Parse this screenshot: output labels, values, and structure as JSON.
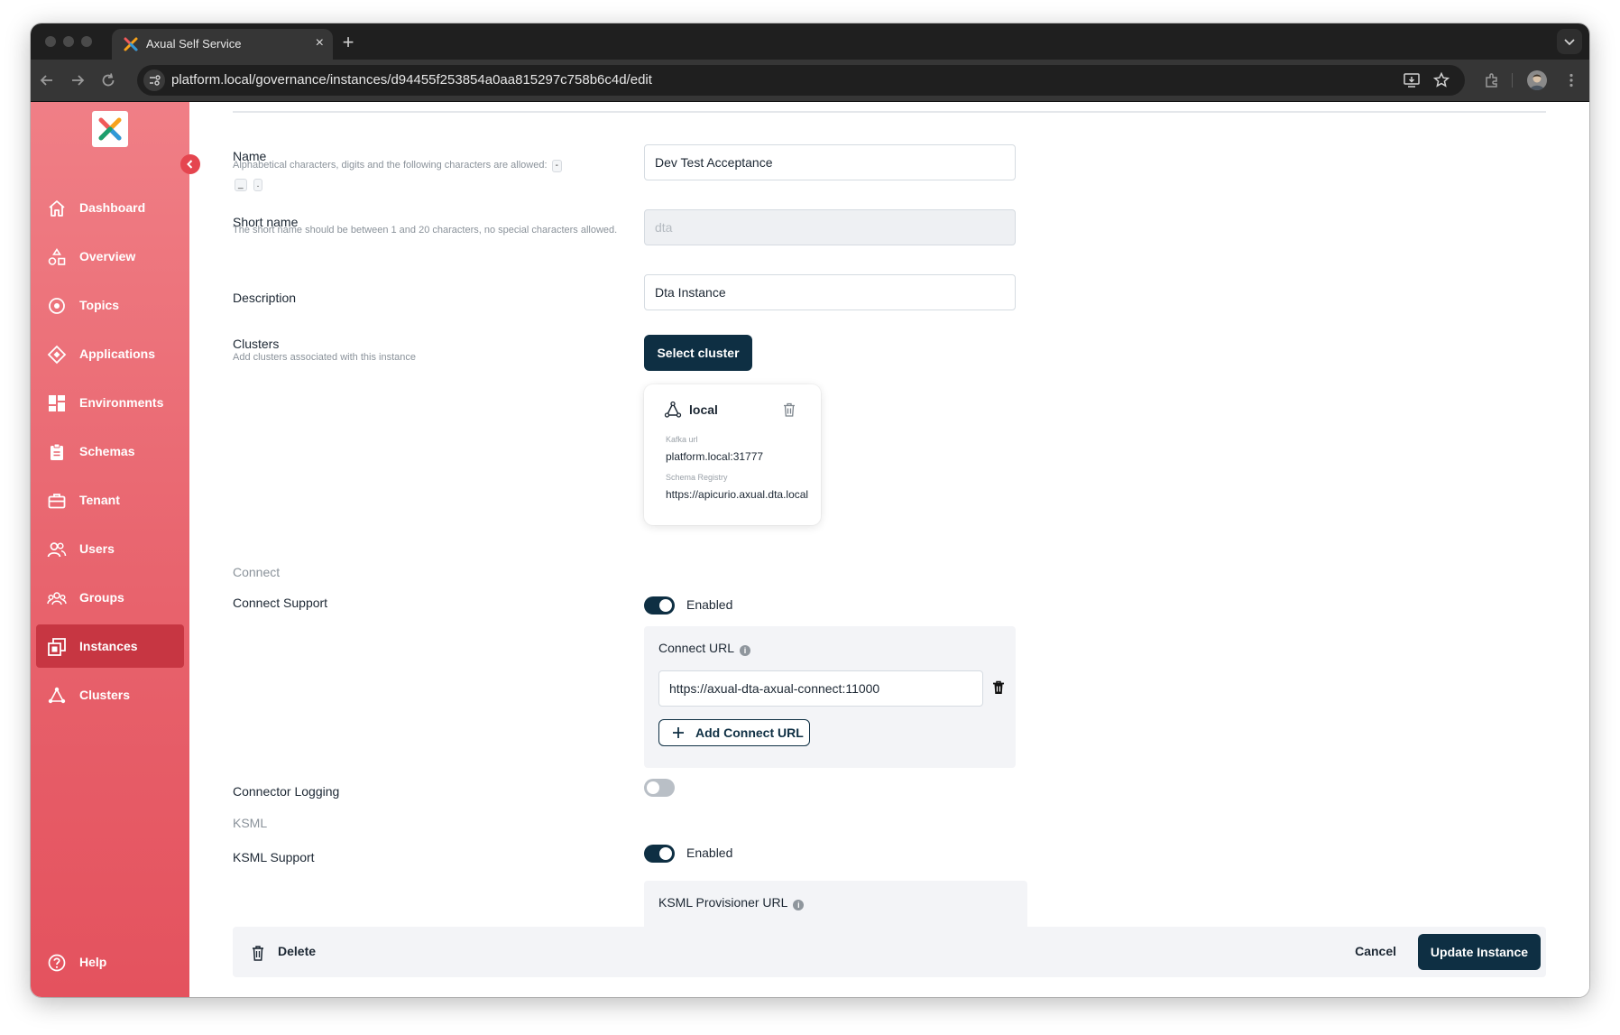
{
  "browser": {
    "tab_title": "Axual Self Service",
    "tab_close": "×",
    "new_tab": "+",
    "url": "platform.local/governance/instances/d94455f253854a0aa815297c758b6c4d/edit"
  },
  "sidebar": {
    "items": [
      {
        "label": "Dashboard",
        "icon": "home-icon"
      },
      {
        "label": "Overview",
        "icon": "shapes-icon"
      },
      {
        "label": "Topics",
        "icon": "topic-icon"
      },
      {
        "label": "Applications",
        "icon": "diamond-icon"
      },
      {
        "label": "Environments",
        "icon": "grid-icon"
      },
      {
        "label": "Schemas",
        "icon": "clipboard-icon"
      },
      {
        "label": "Tenant",
        "icon": "tenant-icon"
      },
      {
        "label": "Users",
        "icon": "users-icon"
      },
      {
        "label": "Groups",
        "icon": "groups-icon"
      },
      {
        "label": "Instances",
        "icon": "instances-icon"
      },
      {
        "label": "Clusters",
        "icon": "cluster-icon"
      }
    ],
    "active": "Instances",
    "help": "Help"
  },
  "form": {
    "name": {
      "label": "Name",
      "help": "Alphabetical characters, digits and the following characters are allowed:",
      "chars": [
        "-",
        "_",
        "."
      ],
      "value": "Dev Test Acceptance"
    },
    "short_name": {
      "label": "Short name",
      "help": "The short name should be between 1 and 20 characters, no special characters allowed.",
      "value": "dta"
    },
    "description": {
      "label": "Description",
      "value": "Dta Instance"
    },
    "clusters": {
      "label": "Clusters",
      "help": "Add clusters associated with this instance",
      "button": "Select cluster",
      "card": {
        "name": "local",
        "kafka_label": "Kafka url",
        "kafka_url": "platform.local:31777",
        "schema_label": "Schema Registry",
        "schema_url": "https://apicurio.axual.dta.local"
      }
    },
    "connect": {
      "section": "Connect",
      "support_label": "Connect Support",
      "support_state": "Enabled",
      "url_title": "Connect URL",
      "url_value": "https://axual-dta-axual-connect:11000",
      "add_button": "Add Connect URL",
      "logging_label": "Connector Logging"
    },
    "ksml": {
      "section": "KSML",
      "support_label": "KSML Support",
      "support_state": "Enabled",
      "provisioner_title": "KSML Provisioner URL"
    },
    "info_glyph": "i"
  },
  "footer": {
    "delete": "Delete",
    "cancel": "Cancel",
    "update": "Update Instance"
  },
  "colors": {
    "primary": "#0e2f43",
    "sidebar": "#e8636d",
    "sidebar_active": "#c73642"
  }
}
